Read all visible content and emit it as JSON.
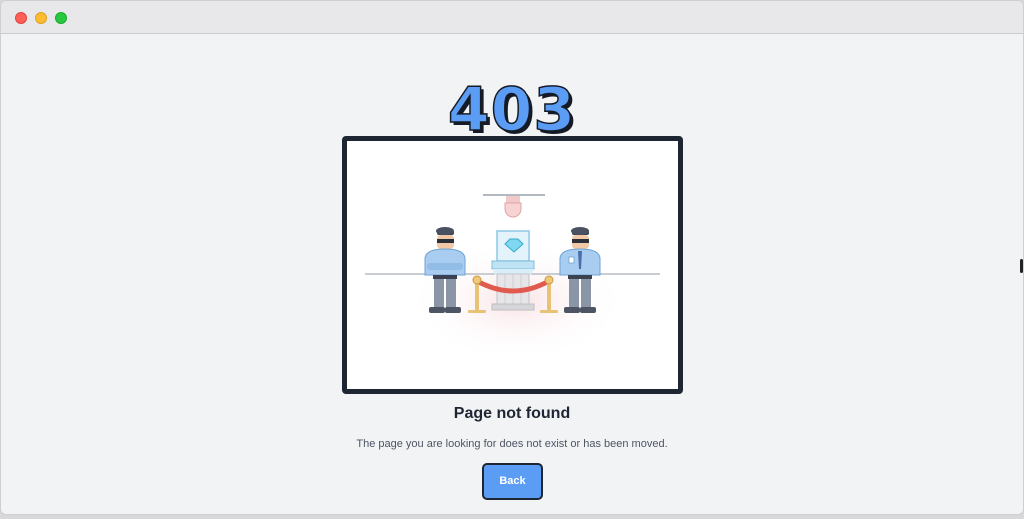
{
  "window": {
    "controls": [
      "close",
      "minimize",
      "maximize"
    ]
  },
  "error": {
    "code": "403",
    "title": "Page not found",
    "message": "The page you are looking for does not exist or has been moved."
  },
  "actions": {
    "back_label": "Back"
  },
  "illustration": {
    "name": "security-guards-diamond-illustration"
  },
  "colors": {
    "accent": "#5b9df5",
    "border": "#1e2533",
    "background": "#f2f3f5"
  }
}
